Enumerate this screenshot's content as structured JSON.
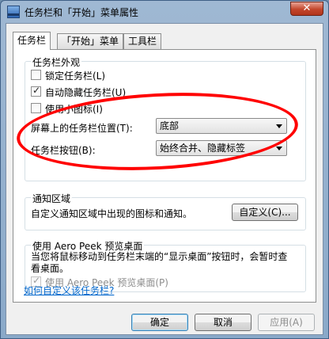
{
  "window": {
    "title": "任务栏和「开始」菜单属性",
    "close_glyph": "✕"
  },
  "tabs": [
    {
      "label": "任务栏",
      "active": true
    },
    {
      "label": "「开始」菜单",
      "active": false
    },
    {
      "label": "工具栏",
      "active": false
    }
  ],
  "appearance": {
    "group_label": "任务栏外观",
    "lock_taskbar": {
      "label": "锁定任务栏(L)",
      "checked": false
    },
    "auto_hide": {
      "label": "自动隐藏任务栏(U)",
      "checked": true
    },
    "small_icons": {
      "label": "使用小图标(I)",
      "checked": false
    },
    "location_label": "屏幕上的任务栏位置(T):",
    "location_value": "底部",
    "buttons_label": "任务栏按钮(B):",
    "buttons_value": "始终合并、隐藏标签"
  },
  "notification": {
    "group_label": "通知区域",
    "description": "自定义通知区域中出现的图标和通知。",
    "customize_button": "自定义(C)..."
  },
  "aero_peek": {
    "group_label": "使用 Aero Peek 预览桌面",
    "description": "当您将鼠标移动到任务栏末端的“显示桌面”按钮时，会暂时查看桌面。",
    "checkbox": {
      "label": "使用 Aero Peek 预览桌面(P)",
      "checked": true
    }
  },
  "help_link": "如何自定义该任务栏?",
  "footer": {
    "ok": "确定",
    "cancel": "取消",
    "apply": "应用(A)"
  },
  "annotation": {
    "color": "#ff0000"
  }
}
